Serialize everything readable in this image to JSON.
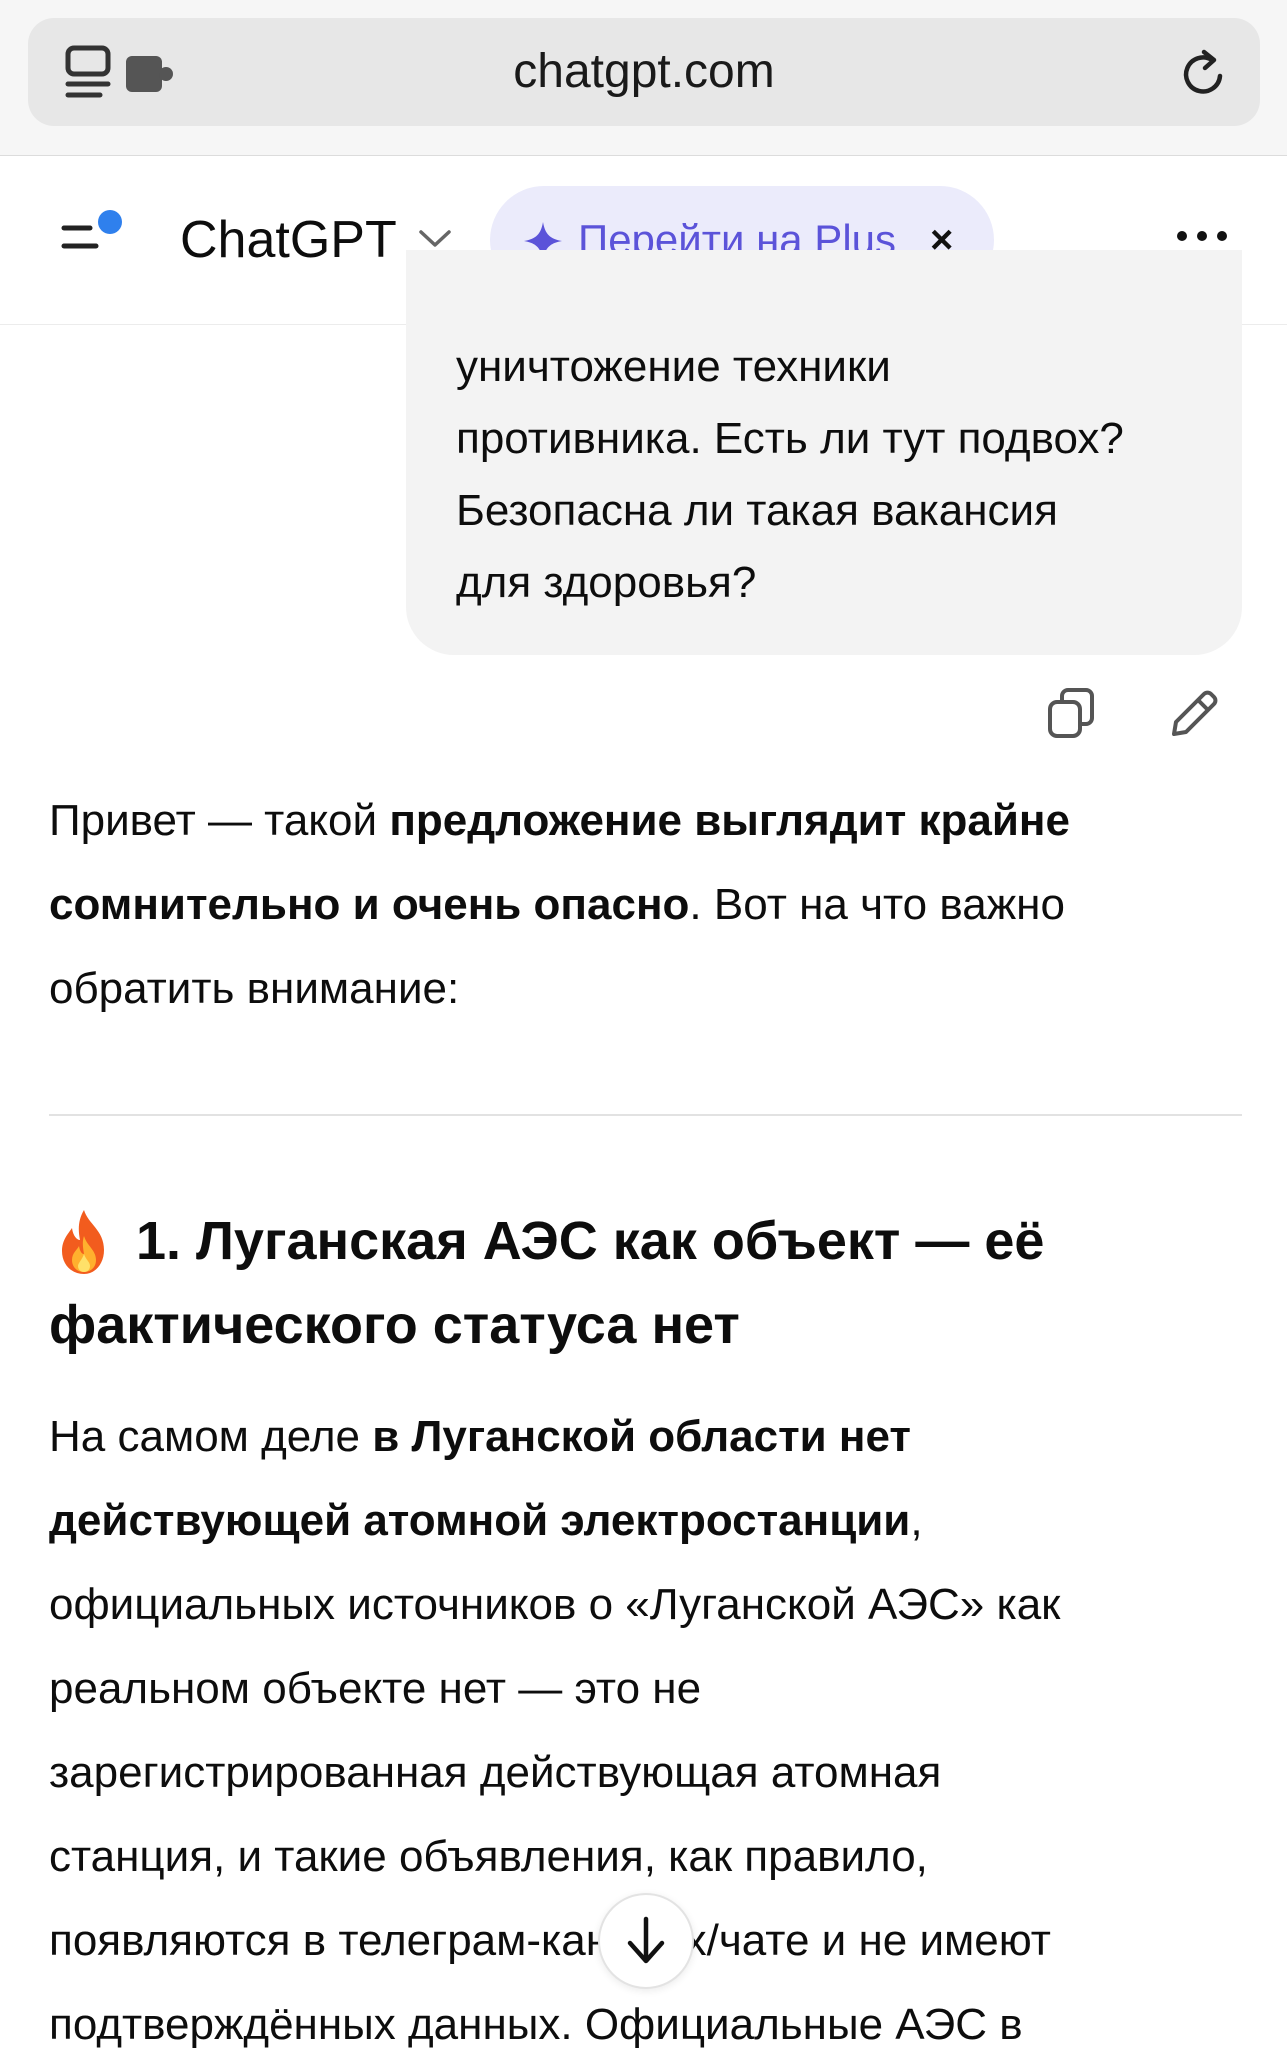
{
  "browser": {
    "url": "chatgpt.com",
    "icons": [
      "tabs-icon",
      "extension-icon",
      "reload-icon"
    ]
  },
  "header": {
    "app_title": "ChatGPT",
    "upgrade_label": "Перейти на Plus",
    "upgrade_close": "×",
    "upgrade_color": "#5b53d9",
    "notification_dot_color": "#2f80ed",
    "icons": [
      "sidebar-toggle-icon",
      "chevron-down-icon",
      "sparkle-icon",
      "more-icon"
    ]
  },
  "user_message": {
    "lines": [
      "уничтожение техники",
      "противника. Есть ли тут подвох?",
      "Безопасна ли такая вакансия",
      "для здоровья?"
    ],
    "actions": [
      "copy-icon",
      "edit-icon"
    ]
  },
  "assistant": {
    "intro": {
      "line1_plain": "Привет — такой ",
      "line1_bold": "предложение выглядит крайне",
      "line2_bold": "сомнительно и очень опасно",
      "line2_plain": ". Вот на что важно",
      "line3_plain": "обратить внимание:"
    },
    "section1": {
      "emoji": "🔥",
      "heading_line1": "1. Луганская АЭС как объект — её",
      "heading_line2": "фактического статуса нет",
      "p_line1_plain": "На самом деле ",
      "p_line1_bold": "в Луганской области нет",
      "p_line2_bold": "действующей атомной электростанции",
      "p_line2_plain": ",",
      "p_line3": "официальных источников о «Луганской АЭС» как",
      "p_line4": "реальном объекте нет — это не",
      "p_line5": "зарегистрированная действующая атомная",
      "p_line6": "станция, и такие объявления, как правило,",
      "p_line7": "появляются в телеграм-каналах/чате и не имеют",
      "p_line8": "подтверждённых данных. Официальные АЭС в"
    }
  },
  "scroll_button": {
    "icon": "arrow-down-icon"
  }
}
